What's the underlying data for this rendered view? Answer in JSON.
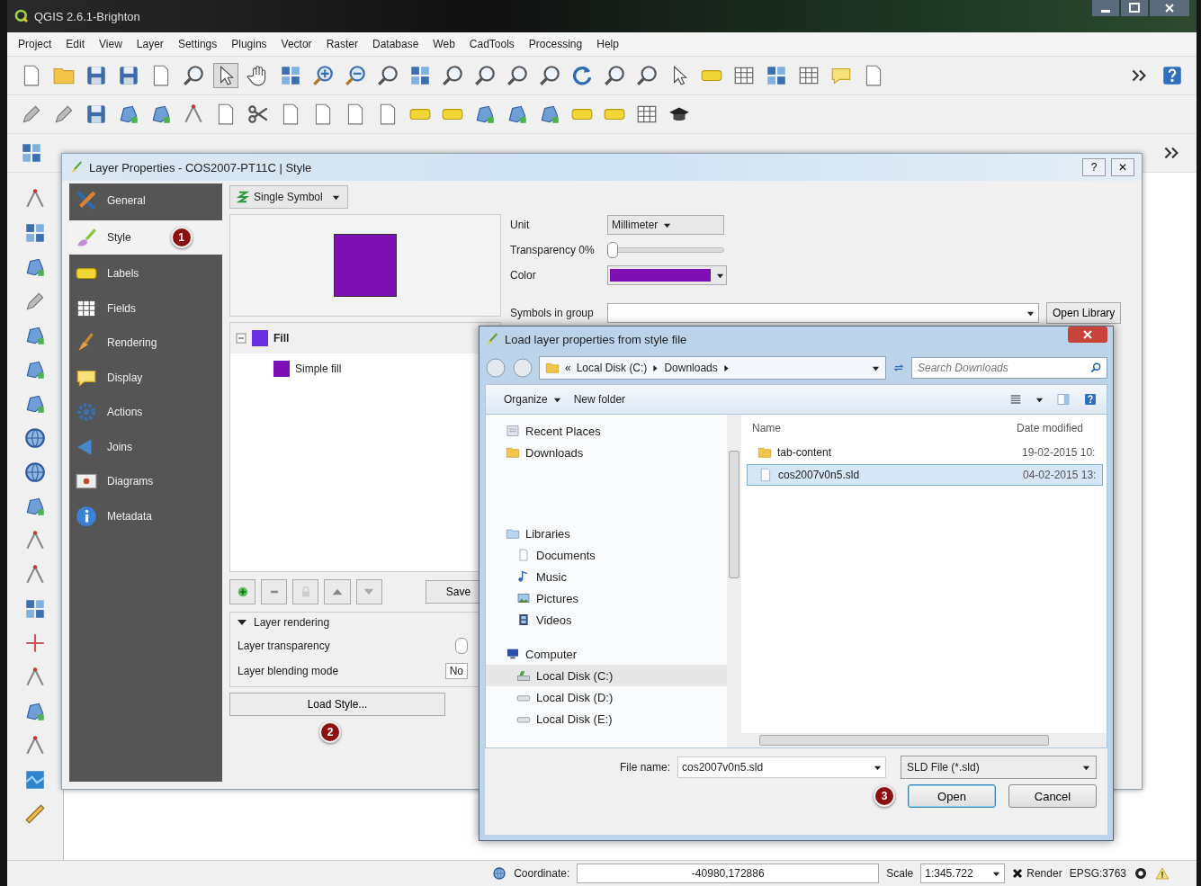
{
  "window": {
    "title": "QGIS 2.6.1-Brighton"
  },
  "menu": [
    "Project",
    "Edit",
    "View",
    "Layer",
    "Settings",
    "Plugins",
    "Vector",
    "Raster",
    "Database",
    "Web",
    "CadTools",
    "Processing",
    "Help"
  ],
  "layer_properties": {
    "title": "Layer Properties - COS2007-PT11C | Style",
    "title_buttons": [
      "?",
      "✕"
    ],
    "sidebar": [
      {
        "label": "General",
        "selected": false
      },
      {
        "label": "Style",
        "selected": true,
        "badge": "1"
      },
      {
        "label": "Labels",
        "selected": false
      },
      {
        "label": "Fields",
        "selected": false
      },
      {
        "label": "Rendering",
        "selected": false
      },
      {
        "label": "Display",
        "selected": false
      },
      {
        "label": "Actions",
        "selected": false
      },
      {
        "label": "Joins",
        "selected": false
      },
      {
        "label": "Diagrams",
        "selected": false
      },
      {
        "label": "Metadata",
        "selected": false
      }
    ],
    "renderer": "Single Symbol",
    "symbol_layers": [
      {
        "label": "Fill",
        "expanded": true,
        "children": [
          {
            "label": "Simple fill"
          }
        ]
      }
    ],
    "save_button": "Save",
    "layer_rendering": {
      "title": "Layer rendering",
      "expanded": true,
      "rows": [
        {
          "label": "Layer transparency"
        },
        {
          "label": "Layer blending mode",
          "value": "No"
        }
      ]
    },
    "load_style_button": "Load Style...",
    "load_badge": "2",
    "unit": {
      "label": "Unit",
      "value": "Millimeter"
    },
    "transparency": {
      "label": "Transparency 0%",
      "level": 0
    },
    "color_label": "Color",
    "symbols_in_group": {
      "label": "Symbols in group"
    },
    "open_library_button": "Open Library"
  },
  "file_dialog": {
    "title": "Load layer properties from style file",
    "path_prefix": "«",
    "path": [
      "Local Disk (C:)",
      "Downloads"
    ],
    "search_placeholder": "Search Downloads",
    "commands": [
      {
        "label": "Organize",
        "dropdown": true
      },
      {
        "label": "New folder",
        "dropdown": false
      }
    ],
    "nav": [
      {
        "label": "Recent Places",
        "kind": "recent",
        "selected": false
      },
      {
        "label": "Downloads",
        "kind": "folder",
        "selected": false
      },
      {
        "label": "Libraries",
        "kind": "library",
        "selected": false,
        "children": [
          {
            "label": "Documents",
            "kind": "documents",
            "selected": false
          },
          {
            "label": "Music",
            "kind": "music",
            "selected": false
          },
          {
            "label": "Pictures",
            "kind": "pictures",
            "selected": false
          },
          {
            "label": "Videos",
            "kind": "videos",
            "selected": false
          }
        ]
      },
      {
        "label": "Computer",
        "kind": "computer",
        "selected": false,
        "children": [
          {
            "label": "Local Disk (C:)",
            "kind": "system-drive",
            "selected": true
          },
          {
            "label": "Local Disk (D:)",
            "kind": "drive",
            "selected": false
          },
          {
            "label": "Local Disk (E:)",
            "kind": "drive",
            "selected": false
          }
        ]
      }
    ],
    "columns": [
      "Name",
      "Date modified"
    ],
    "files": [
      {
        "name": "tab-content",
        "date": "19-02-2015 10:",
        "kind": "folder",
        "selected": false
      },
      {
        "name": "cos2007v0n5.sld",
        "date": "04-02-2015 13:",
        "kind": "file",
        "selected": true
      }
    ],
    "file_name": {
      "label": "File name:",
      "value": "cos2007v0n5.sld"
    },
    "filter": "SLD File (*.sld)",
    "badge": "3",
    "buttons": [
      "Open",
      "Cancel"
    ]
  },
  "status_bar": {
    "coordinate_label": "Coordinate:",
    "coordinate": "-40980,172886",
    "scale_label": "Scale",
    "scale": "1:345.722",
    "render": {
      "label": "Render",
      "checked": true
    },
    "crs": "EPSG:3763"
  }
}
